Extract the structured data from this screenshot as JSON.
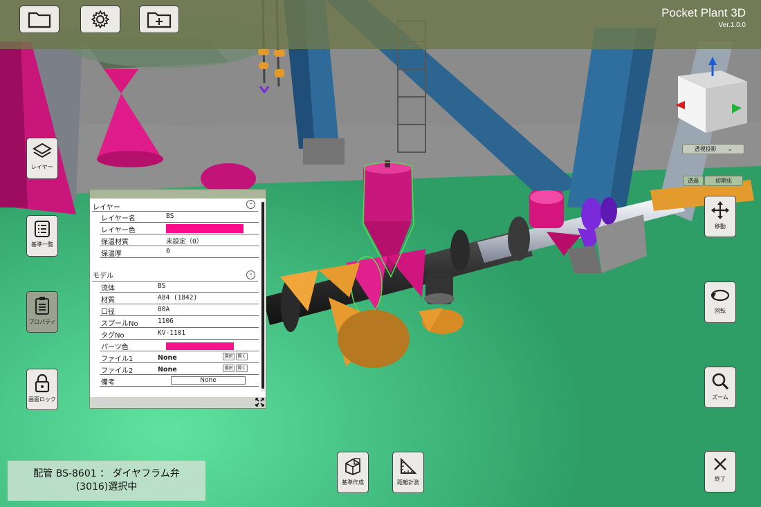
{
  "app": {
    "title": "Pocket Plant 3D",
    "version": "Ver.1.0.0"
  },
  "toolbar": {
    "open_icon": "folder-icon",
    "settings_icon": "gear-icon",
    "add_icon": "folder-plus-icon"
  },
  "left_tools": {
    "layer": "レイヤー",
    "reference_list": "基準一覧",
    "property": "プロパティ",
    "screen_lock": "画面ロック"
  },
  "right_tools": {
    "move": "移動",
    "rotate": "回転",
    "zoom": "ズーム",
    "exit": "終了"
  },
  "bottom_tools": {
    "create_reference": "基準作成",
    "distance_measure": "距離計測"
  },
  "view": {
    "projection": "透視投影",
    "transparent": "透過",
    "reset": "初期化"
  },
  "panel": {
    "layer_section": {
      "title": "レイヤー",
      "collapse": "-",
      "rows": {
        "name_label": "レイヤー名",
        "name_value": "BS",
        "color_label": "レイヤー色",
        "insulation_label": "保温材質",
        "insulation_value": "未設定（0）",
        "thickness_label": "保温厚",
        "thickness_value": "0"
      }
    },
    "model_section": {
      "title": "モデル",
      "collapse": "-",
      "rows": {
        "fluid_label": "流体",
        "fluid_value": "BS",
        "material_label": "材質",
        "material_value": "A84 (1842)",
        "diameter_label": "口径",
        "diameter_value": "80A",
        "spool_label": "スプールNo",
        "spool_value": "1106",
        "tag_label": "タグNo",
        "tag_value": "KV-1101",
        "part_color_label": "パーツ色",
        "file1_label": "ファイル1",
        "file1_value": "None",
        "file2_label": "ファイル2",
        "file2_value": "None",
        "note_label": "備考",
        "note_value": "None"
      }
    },
    "select_label": "選択",
    "open_label": "開く"
  },
  "colors": {
    "layer_color": "#ff0a8c",
    "part_color": "#f5148c"
  },
  "status": {
    "line1": "配管 BS-8601 ： ダイヤフラム弁",
    "line2": "(3016)選択中"
  }
}
